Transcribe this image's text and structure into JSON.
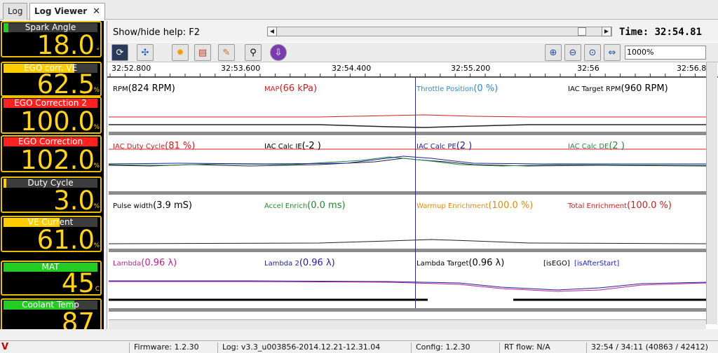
{
  "tabs": [
    {
      "label": "Log"
    },
    {
      "label": "Log Viewer"
    }
  ],
  "colors": {
    "gauge_border": "#e8c000",
    "gauge_value": "#ffd21e",
    "cursor_line": "#2c2c8c"
  },
  "gauges": [
    {
      "label": "Spark Angle",
      "value": "18.0",
      "unit": "°",
      "bar_fraction": 0.05,
      "bar_color": "#22cc22"
    },
    {
      "label": "EGO corr. VE",
      "value": "62.5",
      "unit": "%",
      "bar_fraction": 0.75,
      "bar_color": "#ffcc00"
    },
    {
      "label": "EGO Correction 2",
      "value": "100.0",
      "unit": "%",
      "bar_fraction": 1.0,
      "bar_color": "#ff2020"
    },
    {
      "label": "EGO Correction",
      "value": "102.0",
      "unit": "%",
      "bar_fraction": 1.0,
      "bar_color": "#ff2020"
    },
    {
      "label": "Duty Cycle",
      "value": "3.0",
      "unit": "%",
      "bar_fraction": 0.03,
      "bar_color": "#ffcc00"
    },
    {
      "label": "VE Current",
      "value": "61.0",
      "unit": "%",
      "bar_fraction": 0.6,
      "bar_color": "#ffcc00"
    },
    {
      "label": "MAT",
      "value": "45",
      "unit": "C",
      "bar_fraction": 1.0,
      "bar_color": "#22cc22"
    },
    {
      "label": "Coolant Temp",
      "value": "87",
      "unit": "",
      "bar_fraction": 0.75,
      "bar_color": "#22cc22"
    }
  ],
  "help": {
    "text": "Show/hide help: F2"
  },
  "time": {
    "label": "Time:",
    "value": "32:54.81"
  },
  "zoom": {
    "value": "1000%"
  },
  "toolbar_icons": [
    "refresh-icon",
    "network-icon",
    "gear-icon",
    "chart-settings-icon",
    "tools-icon",
    "search-icon",
    "download-icon"
  ],
  "axis": {
    "ticks": [
      "32:52.800",
      "32:53.600",
      "32:54.400",
      "32:55.200",
      "32:56",
      "32:56.8"
    ]
  },
  "panels": [
    {
      "channels": [
        {
          "name": "RPM",
          "value": "(824 RPM)",
          "color": "#000000"
        },
        {
          "name": "MAP",
          "value": "(66 kPa)",
          "color": "#cc2020"
        },
        {
          "name": "Throttle Position",
          "value": "(0 %)",
          "color": "#2a8ad0"
        },
        {
          "name": "IAC Target RPM",
          "value": "(960 RPM)",
          "color": "#000000"
        }
      ]
    },
    {
      "channels": [
        {
          "name": "IAC Duty Cycle",
          "value": "(81 %)",
          "color": "#cc2020"
        },
        {
          "name": "IAC Calc IE",
          "value": "(-2 )",
          "color": "#000000"
        },
        {
          "name": "IAC Calc PE",
          "value": "(2 )",
          "color": "#2020a0"
        },
        {
          "name": "IAC Calc DE",
          "value": "(2 )",
          "color": "#228844"
        }
      ]
    },
    {
      "channels": [
        {
          "name": "Pulse width",
          "value": "(3.9 mS)",
          "color": "#000000"
        },
        {
          "name": "Accel Enrich",
          "value": "(0.0 ms)",
          "color": "#22882a"
        },
        {
          "name": "Warmup Enrichment",
          "value": "(100.0 %)",
          "color": "#e08a10"
        },
        {
          "name": "Total Enrichment",
          "value": "(100.0 %)",
          "color": "#cc2020"
        }
      ]
    },
    {
      "channels": [
        {
          "name": "Lambda",
          "value": "(0.96 λ)",
          "color": "#c02090"
        },
        {
          "name": "Lambda 2",
          "value": "(0.96 λ)",
          "color": "#2020a0"
        },
        {
          "name": "Lambda Target",
          "value": "(0.96 λ)",
          "color": "#000000"
        },
        {
          "name": "[isEGO]",
          "value": "",
          "color": "#000000"
        },
        {
          "name": "[isAfterStart]",
          "value": "",
          "color": "#2020c0"
        }
      ]
    }
  ],
  "status": {
    "firmware": "Firmware: 1.2.30",
    "log": "Log: v3.3_u003856-2014.12.21-12.31.04",
    "config": "Config: 1.2.30",
    "rtflow": "RT flow: N/A",
    "position": "32:54 / 34:11 (40863 / 42412)"
  }
}
